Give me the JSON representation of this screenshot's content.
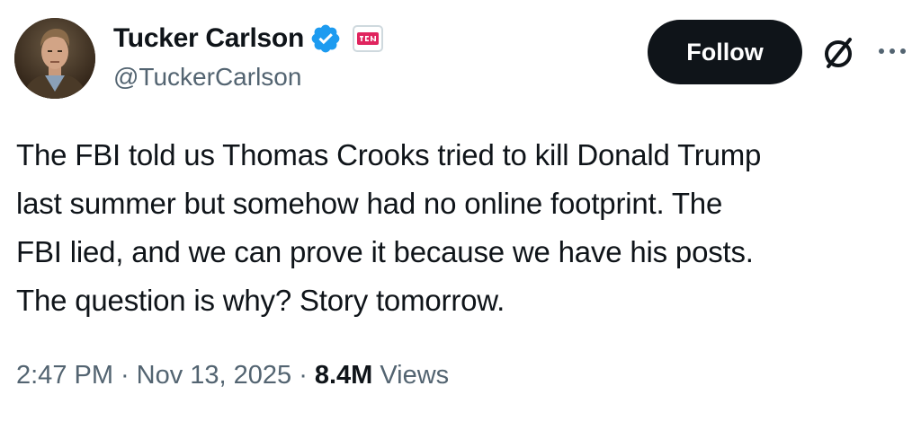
{
  "author": {
    "display_name": "Tucker Carlson",
    "handle": "@TuckerCarlson",
    "verified": true,
    "verified_color": "#1d9bf0",
    "affiliate_badge_icon": "tcn-logo-icon",
    "avatar_icon": "profile-photo"
  },
  "actions": {
    "follow_label": "Follow",
    "grok_icon": "grok-icon",
    "more_icon": "more-options-icon"
  },
  "tweet": {
    "text_lines": [
      "The FBI told us Thomas Crooks tried to kill Donald Trump",
      "last summer but somehow had no online footprint. The",
      "FBI lied, and we can prove it because we have his posts.",
      "The question is why? Story tomorrow."
    ]
  },
  "meta": {
    "time": "2:47 PM",
    "separator": "·",
    "date": "Nov 13, 2025",
    "views_count": "8.4M",
    "views_label": "Views"
  },
  "colors": {
    "text_primary": "#0f1419",
    "text_secondary": "#536471",
    "button_bg": "#0f1419",
    "button_text": "#ffffff",
    "badge_red": "#e0245e"
  }
}
